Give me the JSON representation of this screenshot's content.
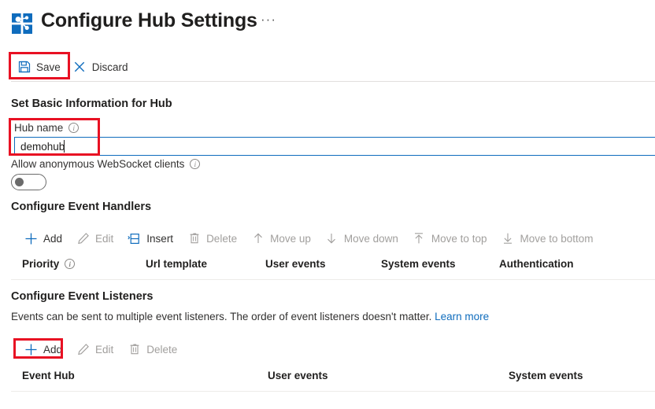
{
  "header": {
    "title": "Configure Hub Settings",
    "icon": "web-pubsub-hub-icon",
    "more_label": "···"
  },
  "command_bar": {
    "items": [
      {
        "label": "Save",
        "icon": "save-icon",
        "enabled": true
      },
      {
        "label": "Discard",
        "icon": "close-icon",
        "enabled": true
      }
    ]
  },
  "basic_info": {
    "section_title": "Set Basic Information for Hub",
    "hub_name": {
      "label": "Hub name",
      "info_icon": "info-icon",
      "value": "demohub",
      "placeholder": ""
    },
    "allow_anonymous": {
      "label": "Allow anonymous WebSocket clients",
      "info_icon": "info-icon",
      "state": "off"
    }
  },
  "event_handlers": {
    "section_title": "Configure Event Handlers",
    "toolbar": [
      {
        "label": "Add",
        "icon": "plus-icon",
        "enabled": true
      },
      {
        "label": "Edit",
        "icon": "pencil-icon",
        "enabled": false
      },
      {
        "label": "Insert",
        "icon": "insert-row-icon",
        "enabled": true
      },
      {
        "label": "Delete",
        "icon": "trash-icon",
        "enabled": false
      },
      {
        "label": "Move up",
        "icon": "arrow-up-icon",
        "enabled": false
      },
      {
        "label": "Move down",
        "icon": "arrow-down-icon",
        "enabled": false
      },
      {
        "label": "Move to top",
        "icon": "arrow-to-top-icon",
        "enabled": false
      },
      {
        "label": "Move to bottom",
        "icon": "arrow-to-bottom-icon",
        "enabled": false
      }
    ],
    "columns": [
      {
        "label": "Priority",
        "info_icon": "info-icon"
      },
      {
        "label": "Url template",
        "info_icon": null
      },
      {
        "label": "User events",
        "info_icon": null
      },
      {
        "label": "System events",
        "info_icon": null
      },
      {
        "label": "Authentication",
        "info_icon": null
      }
    ],
    "rows": []
  },
  "event_listeners": {
    "section_title": "Configure Event Listeners",
    "description": "Events can be sent to multiple event listeners. The order of event listeners doesn't matter.",
    "learn_more": "Learn more",
    "toolbar": [
      {
        "label": "Add",
        "icon": "plus-icon",
        "enabled": true
      },
      {
        "label": "Edit",
        "icon": "pencil-icon",
        "enabled": false
      },
      {
        "label": "Delete",
        "icon": "trash-icon",
        "enabled": false
      }
    ],
    "columns": [
      {
        "label": "Event Hub"
      },
      {
        "label": "User events"
      },
      {
        "label": "System events"
      }
    ],
    "rows": []
  },
  "highlights": [
    {
      "name": "save-button-highlight"
    },
    {
      "name": "hub-name-field-highlight"
    },
    {
      "name": "listeners-add-button-highlight"
    }
  ],
  "colors": {
    "accent": "#0f6cbd",
    "highlight": "#e81123",
    "disabled_text": "#a19f9d",
    "text": "#323130",
    "heading": "#201f1e",
    "divider": "#e1dfdd"
  }
}
